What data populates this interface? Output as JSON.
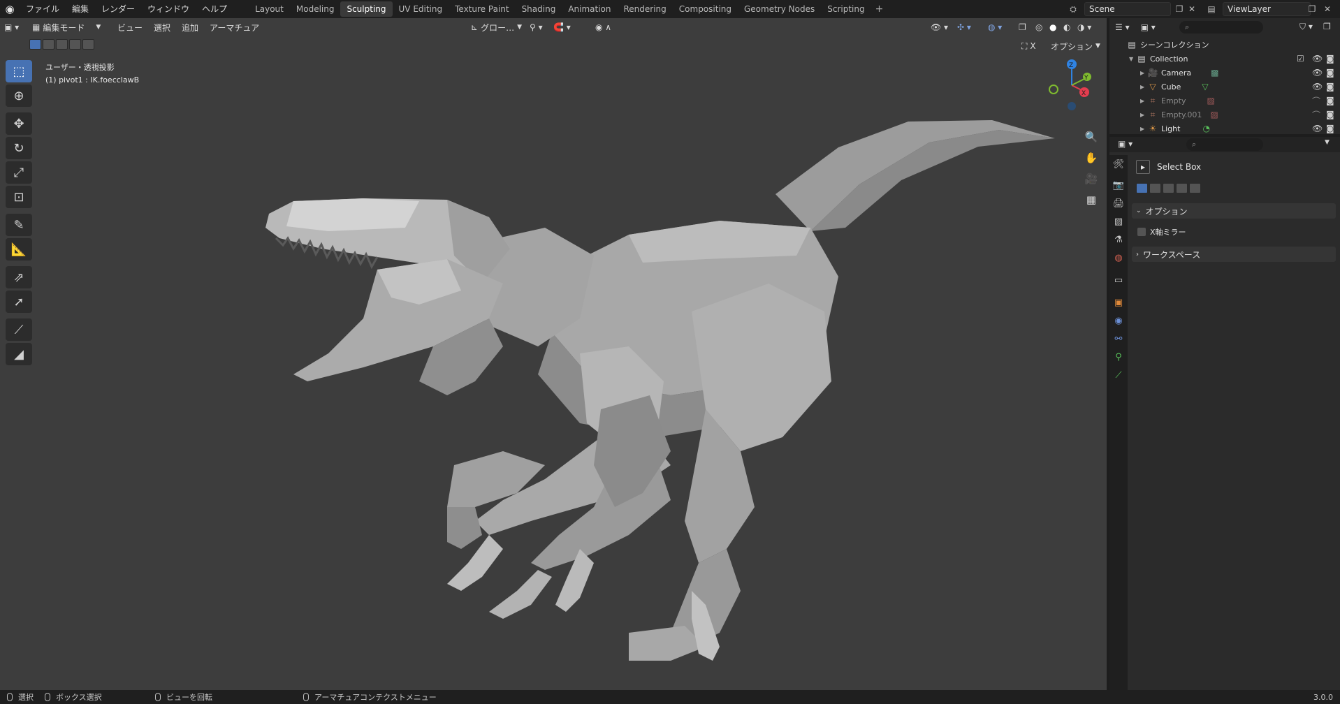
{
  "app_menu": [
    "ファイル",
    "編集",
    "レンダー",
    "ウィンドウ",
    "ヘルプ"
  ],
  "workspaces": {
    "tabs": [
      "Layout",
      "Modeling",
      "Sculpting",
      "UV Editing",
      "Texture Paint",
      "Shading",
      "Animation",
      "Rendering",
      "Compositing",
      "Geometry Nodes",
      "Scripting"
    ],
    "active": "Sculpting",
    "add": "+"
  },
  "scene": "Scene",
  "view_layer": "ViewLayer",
  "viewport": {
    "mode": "編集モード",
    "menus": [
      "ビュー",
      "選択",
      "追加",
      "アーマチュア"
    ],
    "transform_orientation": "グロー…",
    "options_label": "オプション",
    "x_label": "X",
    "info_line1": "ユーザー・透視投影",
    "info_line2": "(1) pivot1 : IK.foecclawB",
    "gizmo": {
      "z": "Z",
      "x": "X",
      "y": "Y"
    }
  },
  "outliner": {
    "title": "シーンコレクション",
    "collection": "Collection",
    "items": [
      {
        "label": "Camera",
        "icon": "camera-icon",
        "dim": false
      },
      {
        "label": "Cube",
        "icon": "mesh-icon",
        "dim": false
      },
      {
        "label": "Empty",
        "icon": "empty-icon",
        "dim": true
      },
      {
        "label": "Empty.001",
        "icon": "empty-icon",
        "dim": true
      },
      {
        "label": "Light",
        "icon": "light-icon",
        "dim": false
      }
    ]
  },
  "properties": {
    "tool_name": "Select Box",
    "panel_options": "オプション",
    "x_mirror": "X軸ミラー",
    "panel_workspace": "ワークスペース"
  },
  "statusbar": {
    "select": "選択",
    "box_select": "ボックス選択",
    "rotate_view": "ビューを回転",
    "context_menu": "アーマチュアコンテクストメニュー",
    "version": "3.0.0"
  },
  "colors": {
    "accent": "#4772b3",
    "viewport_bg": "#3d3d3d",
    "header_bg": "#1f1f1f",
    "gizmo_z": "#2f83e3",
    "gizmo_x": "#e43d4f",
    "gizmo_y": "#7fbb2f"
  }
}
